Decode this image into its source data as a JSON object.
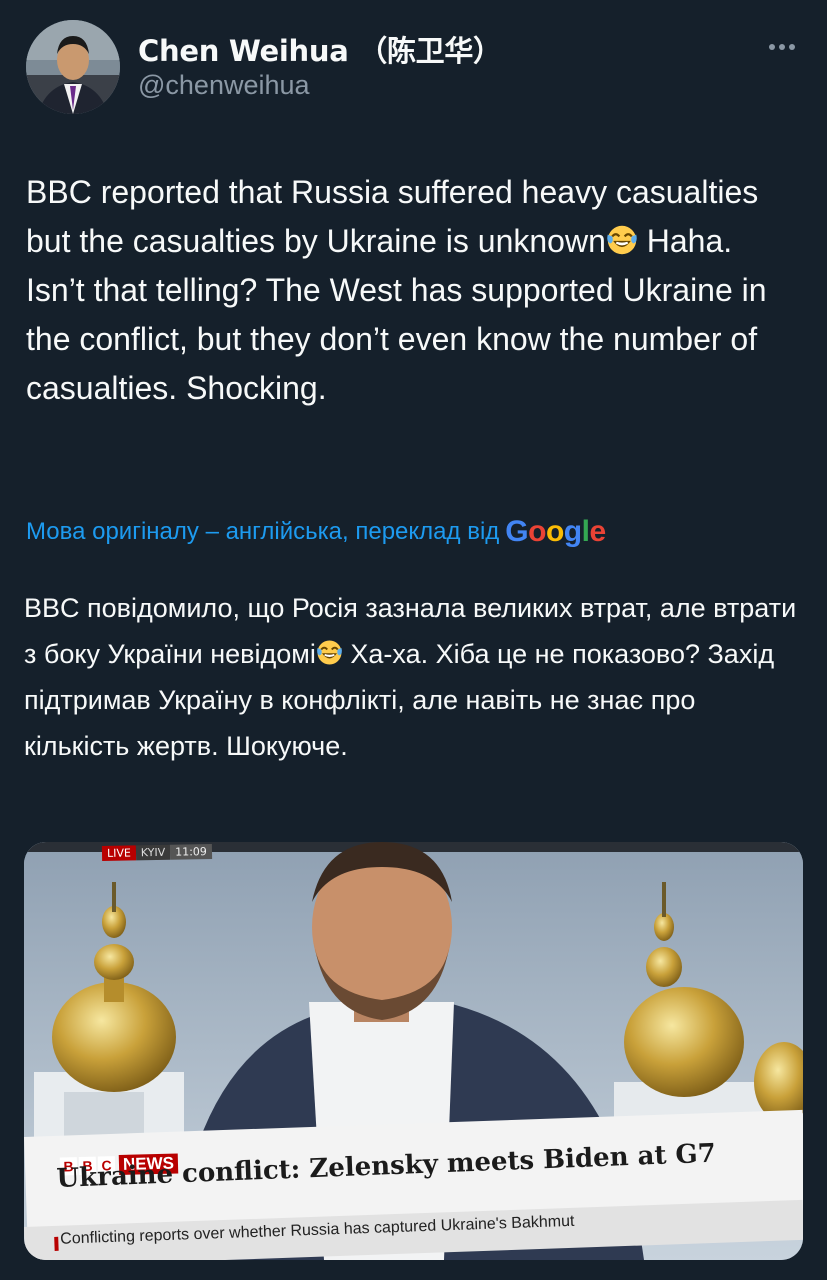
{
  "author": {
    "display_name": "Chen Weihua （陈卫华）",
    "handle": "@chenweihua"
  },
  "tweet": {
    "text": "BBC reported that Russia suffered heavy casualties but the casualties by Ukraine is unknown",
    "text_after_emoji": " Haha. Isn’t that telling? The West has supported Ukraine in the conflict, but they don’t even know the number of casualties. Shocking.",
    "emoji": "face-with-tears-of-joy"
  },
  "translation": {
    "notice": "Мова оригіналу – англійська, переклад від",
    "provider": "Google",
    "text": "BBC повідомило, що Росія зазнала великих втрат, але втрати з боку України невідомі",
    "text_after_emoji": " Ха-ха. Хіба це не показово? Захід підтримав Україну в конфлікті, але навіть не знає про кількість жертв. Шокуюче."
  },
  "media": {
    "live_label": "LIVE",
    "location": "KYIV",
    "time": "11:09",
    "bbc_letters": [
      "B",
      "B",
      "C"
    ],
    "news_label": "NEWS",
    "headline": "Ukraine conflict: Zelensky meets Biden at G7",
    "ticker": "Conflicting reports over whether Russia has captured Ukraine's Bakhmut"
  },
  "colors": {
    "background": "#15202b",
    "text": "#f7f9f9",
    "secondary": "#8b98a5",
    "link": "#1d9bf0",
    "bbc_red": "#b80000"
  },
  "icons": [
    "more-icon",
    "laugh-emoji"
  ]
}
